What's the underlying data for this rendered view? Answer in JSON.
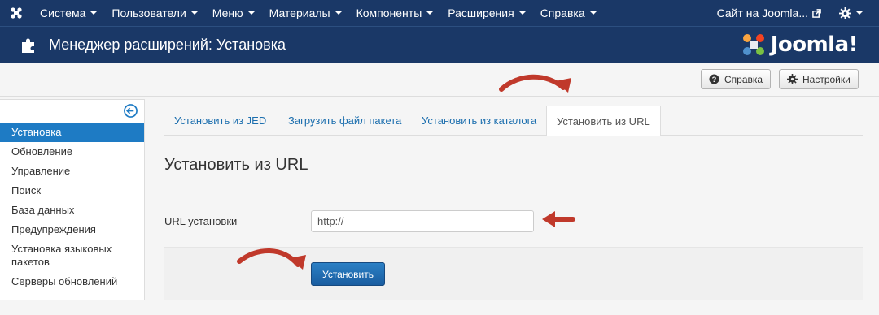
{
  "topnav": {
    "menu": [
      {
        "label": "Система"
      },
      {
        "label": "Пользователи"
      },
      {
        "label": "Меню"
      },
      {
        "label": "Материалы"
      },
      {
        "label": "Компоненты"
      },
      {
        "label": "Расширения"
      },
      {
        "label": "Справка"
      }
    ],
    "site_link": "Сайт на Joomla..."
  },
  "header": {
    "title": "Менеджер расширений: Установка",
    "brand": "Joomla!"
  },
  "toolbar": {
    "help_label": "Справка",
    "options_label": "Настройки"
  },
  "sidebar": {
    "items": [
      {
        "label": "Установка"
      },
      {
        "label": "Обновление"
      },
      {
        "label": "Управление"
      },
      {
        "label": "Поиск"
      },
      {
        "label": "База данных"
      },
      {
        "label": "Предупреждения"
      },
      {
        "label": "Установка языковых пакетов"
      },
      {
        "label": "Серверы обновлений"
      }
    ]
  },
  "tabs": [
    {
      "label": "Установить из JED"
    },
    {
      "label": "Загрузить файл пакета"
    },
    {
      "label": "Установить из каталога"
    },
    {
      "label": "Установить из URL"
    }
  ],
  "main": {
    "section_title": "Установить из URL",
    "field_label": "URL установки",
    "url_value": "http://",
    "install_label": "Установить"
  },
  "colors": {
    "navbar": "#1a3867",
    "accent": "#1e7bc4",
    "arrow": "#c0392b"
  },
  "icons": {
    "logo": "joomla-icon",
    "header": "puzzle-icon",
    "help": "question-icon",
    "options": "gear-icon",
    "collapse": "arrow-left-circle-icon",
    "external": "external-link-icon"
  }
}
